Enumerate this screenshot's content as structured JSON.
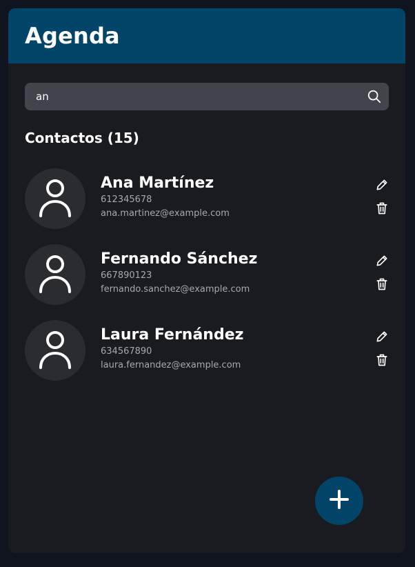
{
  "header": {
    "title": "Agenda"
  },
  "search": {
    "value": "an",
    "icon": "search-icon"
  },
  "contacts_section": {
    "title": "Contactos (15)"
  },
  "contacts": [
    {
      "name": "Ana Martínez",
      "phone": "612345678",
      "email": "ana.martinez@example.com"
    },
    {
      "name": "Fernando Sánchez",
      "phone": "667890123",
      "email": "fernando.sanchez@example.com"
    },
    {
      "name": "Laura Fernández",
      "phone": "634567890",
      "email": "laura.fernandez@example.com"
    }
  ],
  "colors": {
    "page_background": "#10141f",
    "panel_background": "#1a1b20",
    "header_background": "#034569",
    "search_background": "#42434b",
    "avatar_background": "#2b2c31",
    "secondary_text": "#a7a9b0",
    "fab_background": "#034569"
  },
  "icons": {
    "avatar": "user-icon",
    "edit": "pencil-icon",
    "delete": "trash-icon",
    "add": "plus-icon"
  }
}
